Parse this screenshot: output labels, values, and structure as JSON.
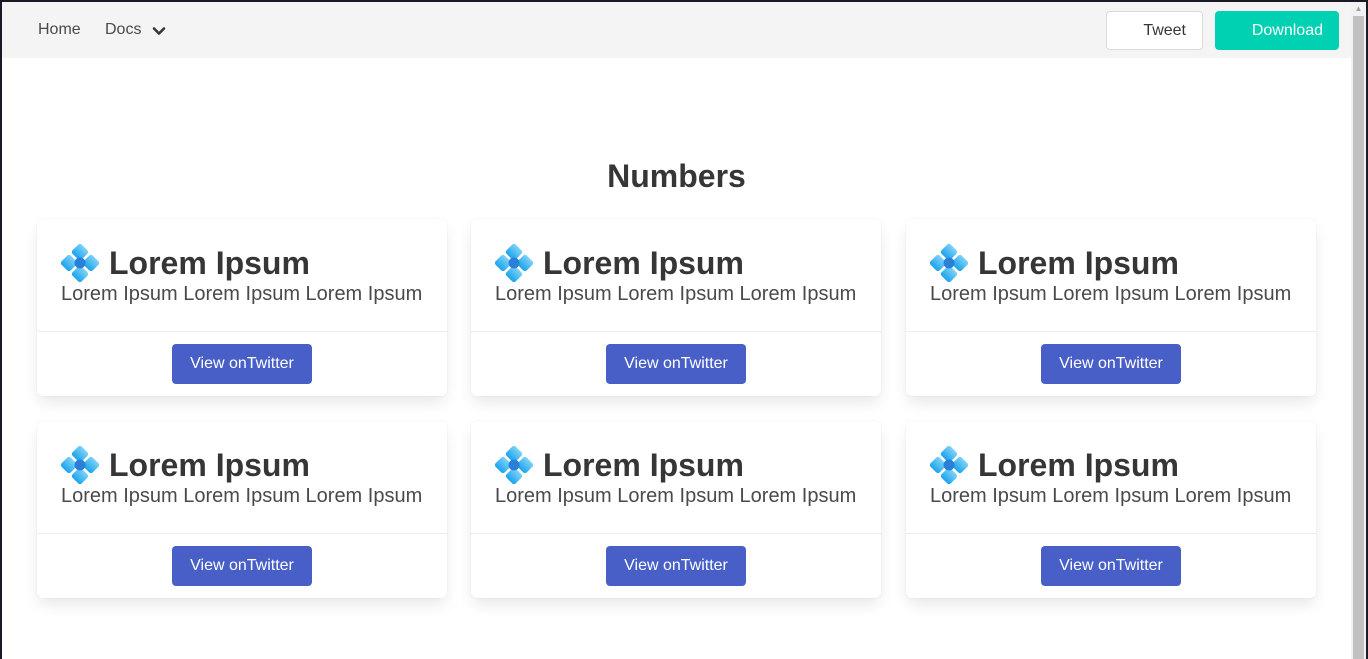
{
  "nav": {
    "home_label": "Home",
    "docs_label": "Docs",
    "docs_icon": "chevron-down-icon",
    "tweet_label": "Tweet",
    "download_label": "Download"
  },
  "section": {
    "title": "Numbers"
  },
  "colors": {
    "navbar_bg": "#f4f4f4",
    "download_accent": "#00d1b2",
    "card_button": "#485fc7",
    "text_dark": "#363636"
  },
  "cards": [
    {
      "icon": "blue-diamond-cluster-icon",
      "title": "Lorem Ipsum",
      "text": "Lorem Ipsum Lorem Ipsum Lorem Ipsum",
      "button_label": "View onTwitter"
    },
    {
      "icon": "blue-diamond-cluster-icon",
      "title": "Lorem Ipsum",
      "text": "Lorem Ipsum Lorem Ipsum Lorem Ipsum",
      "button_label": "View onTwitter"
    },
    {
      "icon": "blue-diamond-cluster-icon",
      "title": "Lorem Ipsum",
      "text": "Lorem Ipsum Lorem Ipsum Lorem Ipsum",
      "button_label": "View onTwitter"
    },
    {
      "icon": "blue-diamond-cluster-icon",
      "title": "Lorem Ipsum",
      "text": "Lorem Ipsum Lorem Ipsum Lorem Ipsum",
      "button_label": "View onTwitter"
    },
    {
      "icon": "blue-diamond-cluster-icon",
      "title": "Lorem Ipsum",
      "text": "Lorem Ipsum Lorem Ipsum Lorem Ipsum",
      "button_label": "View onTwitter"
    },
    {
      "icon": "blue-diamond-cluster-icon",
      "title": "Lorem Ipsum",
      "text": "Lorem Ipsum Lorem Ipsum Lorem Ipsum",
      "button_label": "View onTwitter"
    }
  ]
}
